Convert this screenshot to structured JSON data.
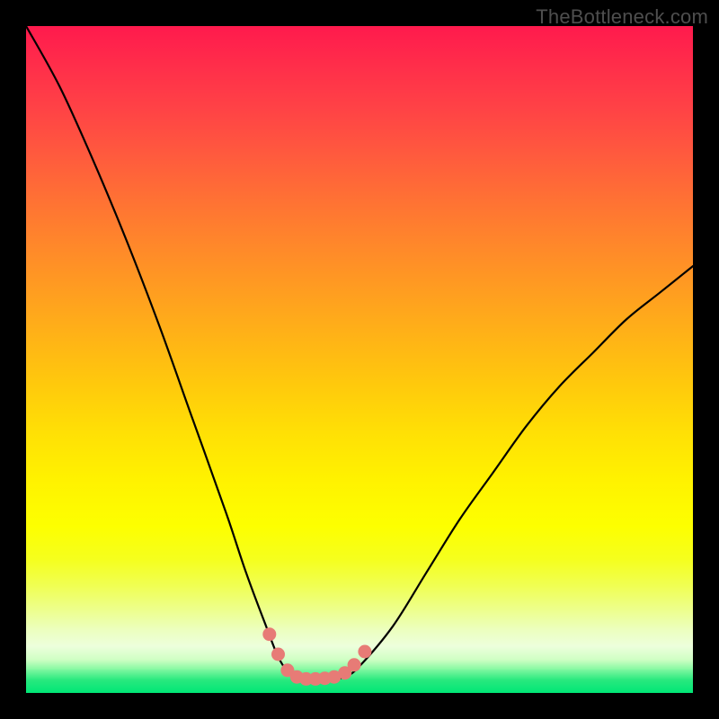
{
  "watermark": "TheBottleneck.com",
  "colors": {
    "frame": "#000000",
    "curve_stroke": "#000000",
    "marker_fill": "#e77b76",
    "gradient_top": "#ff1a4d",
    "gradient_bottom": "#00e676"
  },
  "chart_data": {
    "type": "line",
    "title": "",
    "xlabel": "",
    "ylabel": "",
    "xlim": [
      0,
      100
    ],
    "ylim": [
      0,
      100
    ],
    "series": [
      {
        "name": "bottleneck-curve",
        "x": [
          0,
          5,
          10,
          15,
          20,
          25,
          30,
          33,
          36,
          38,
          40,
          42,
          44,
          46,
          48,
          50,
          55,
          60,
          65,
          70,
          75,
          80,
          85,
          90,
          95,
          100
        ],
        "y": [
          100,
          91,
          80,
          68,
          55,
          41,
          27,
          18,
          10,
          5,
          2.5,
          2,
          2,
          2,
          2.5,
          4,
          10,
          18,
          26,
          33,
          40,
          46,
          51,
          56,
          60,
          64
        ]
      }
    ],
    "markers": {
      "name": "highlighted-points",
      "x": [
        36.5,
        37.8,
        39.2,
        40.6,
        42.0,
        43.4,
        44.8,
        46.2,
        47.8,
        49.2,
        50.8
      ],
      "y": [
        8.8,
        5.8,
        3.4,
        2.4,
        2.1,
        2.1,
        2.2,
        2.4,
        3.0,
        4.2,
        6.2
      ]
    }
  }
}
